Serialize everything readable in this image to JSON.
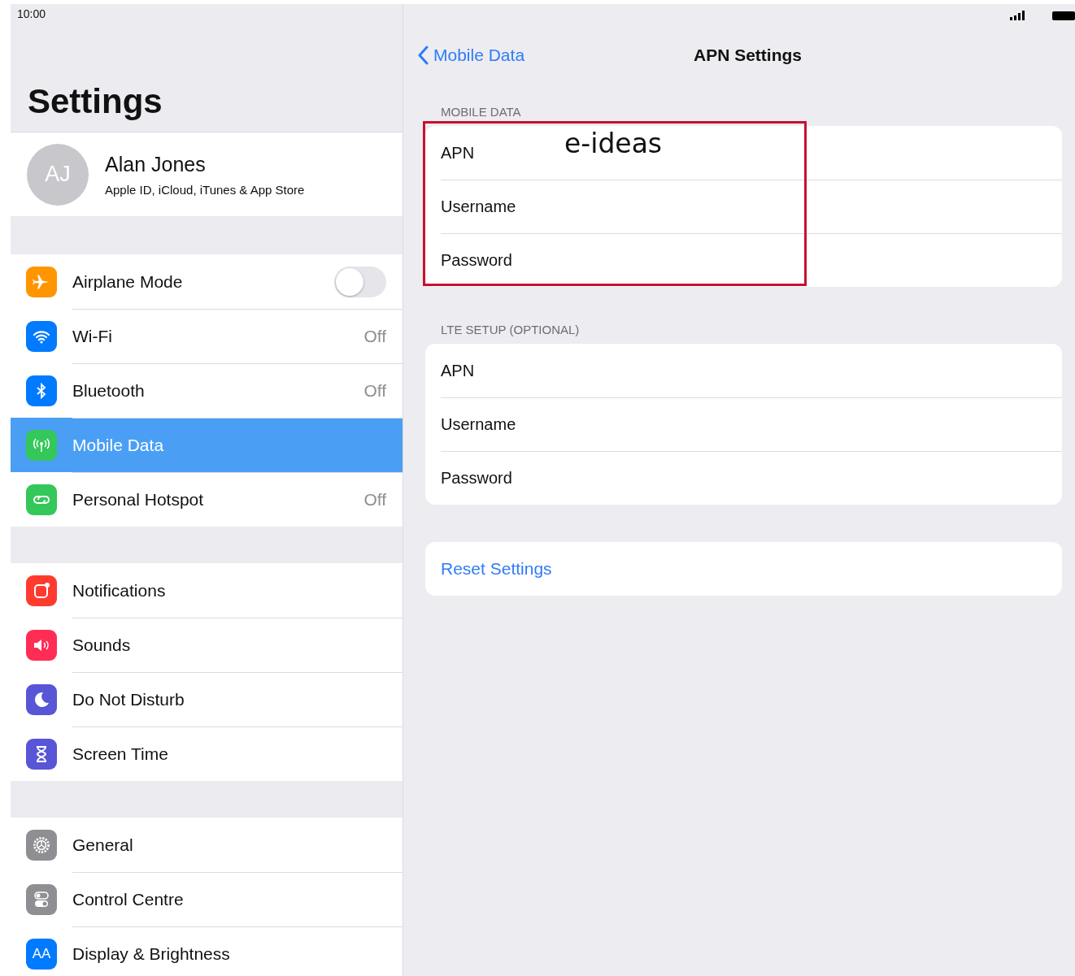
{
  "status_bar": {
    "time": "10:00"
  },
  "sidebar": {
    "title": "Settings",
    "profile": {
      "initials": "AJ",
      "name": "Alan Jones",
      "subtitle": "Apple ID, iCloud, iTunes & App Store"
    },
    "groups": [
      {
        "items": [
          {
            "label": "Airplane Mode",
            "color": "#ff9500",
            "kind": "toggle",
            "on": false,
            "selected": false
          },
          {
            "label": "Wi-Fi",
            "color": "#007aff",
            "kind": "detail",
            "value": "Off",
            "selected": false
          },
          {
            "label": "Bluetooth",
            "color": "#007aff",
            "kind": "detail",
            "value": "Off",
            "selected": false
          },
          {
            "label": "Mobile Data",
            "color": "#34c759",
            "kind": "detail",
            "selected": true
          },
          {
            "label": "Personal Hotspot",
            "color": "#34c759",
            "kind": "detail",
            "value": "Off",
            "selected": false
          }
        ]
      },
      {
        "items": [
          {
            "label": "Notifications",
            "color": "#ff3b30",
            "kind": "detail",
            "selected": false
          },
          {
            "label": "Sounds",
            "color": "#ff2d55",
            "kind": "detail",
            "selected": false
          },
          {
            "label": "Do Not Disturb",
            "color": "#5856d6",
            "kind": "detail",
            "selected": false
          },
          {
            "label": "Screen Time",
            "color": "#5856d6",
            "kind": "detail",
            "selected": false
          }
        ]
      },
      {
        "items": [
          {
            "label": "General",
            "color": "#8e8e93",
            "kind": "detail",
            "selected": false
          },
          {
            "label": "Control Centre",
            "color": "#8e8e93",
            "kind": "detail",
            "selected": false
          },
          {
            "label": "Display & Brightness",
            "icon_text": "AA",
            "color": "#007aff",
            "kind": "detail",
            "selected": false
          }
        ]
      }
    ]
  },
  "detail": {
    "back": "Mobile Data",
    "title": "APN Settings",
    "sections": [
      {
        "header": "MOBILE DATA",
        "highlighted": true,
        "annotation": "e-ideas",
        "fields": [
          {
            "label": "APN"
          },
          {
            "label": "Username"
          },
          {
            "label": "Password"
          }
        ]
      },
      {
        "header": "LTE SETUP (OPTIONAL)",
        "highlighted": false,
        "fields": [
          {
            "label": "APN"
          },
          {
            "label": "Username"
          },
          {
            "label": "Password"
          }
        ]
      }
    ],
    "reset_button": "Reset Settings"
  }
}
